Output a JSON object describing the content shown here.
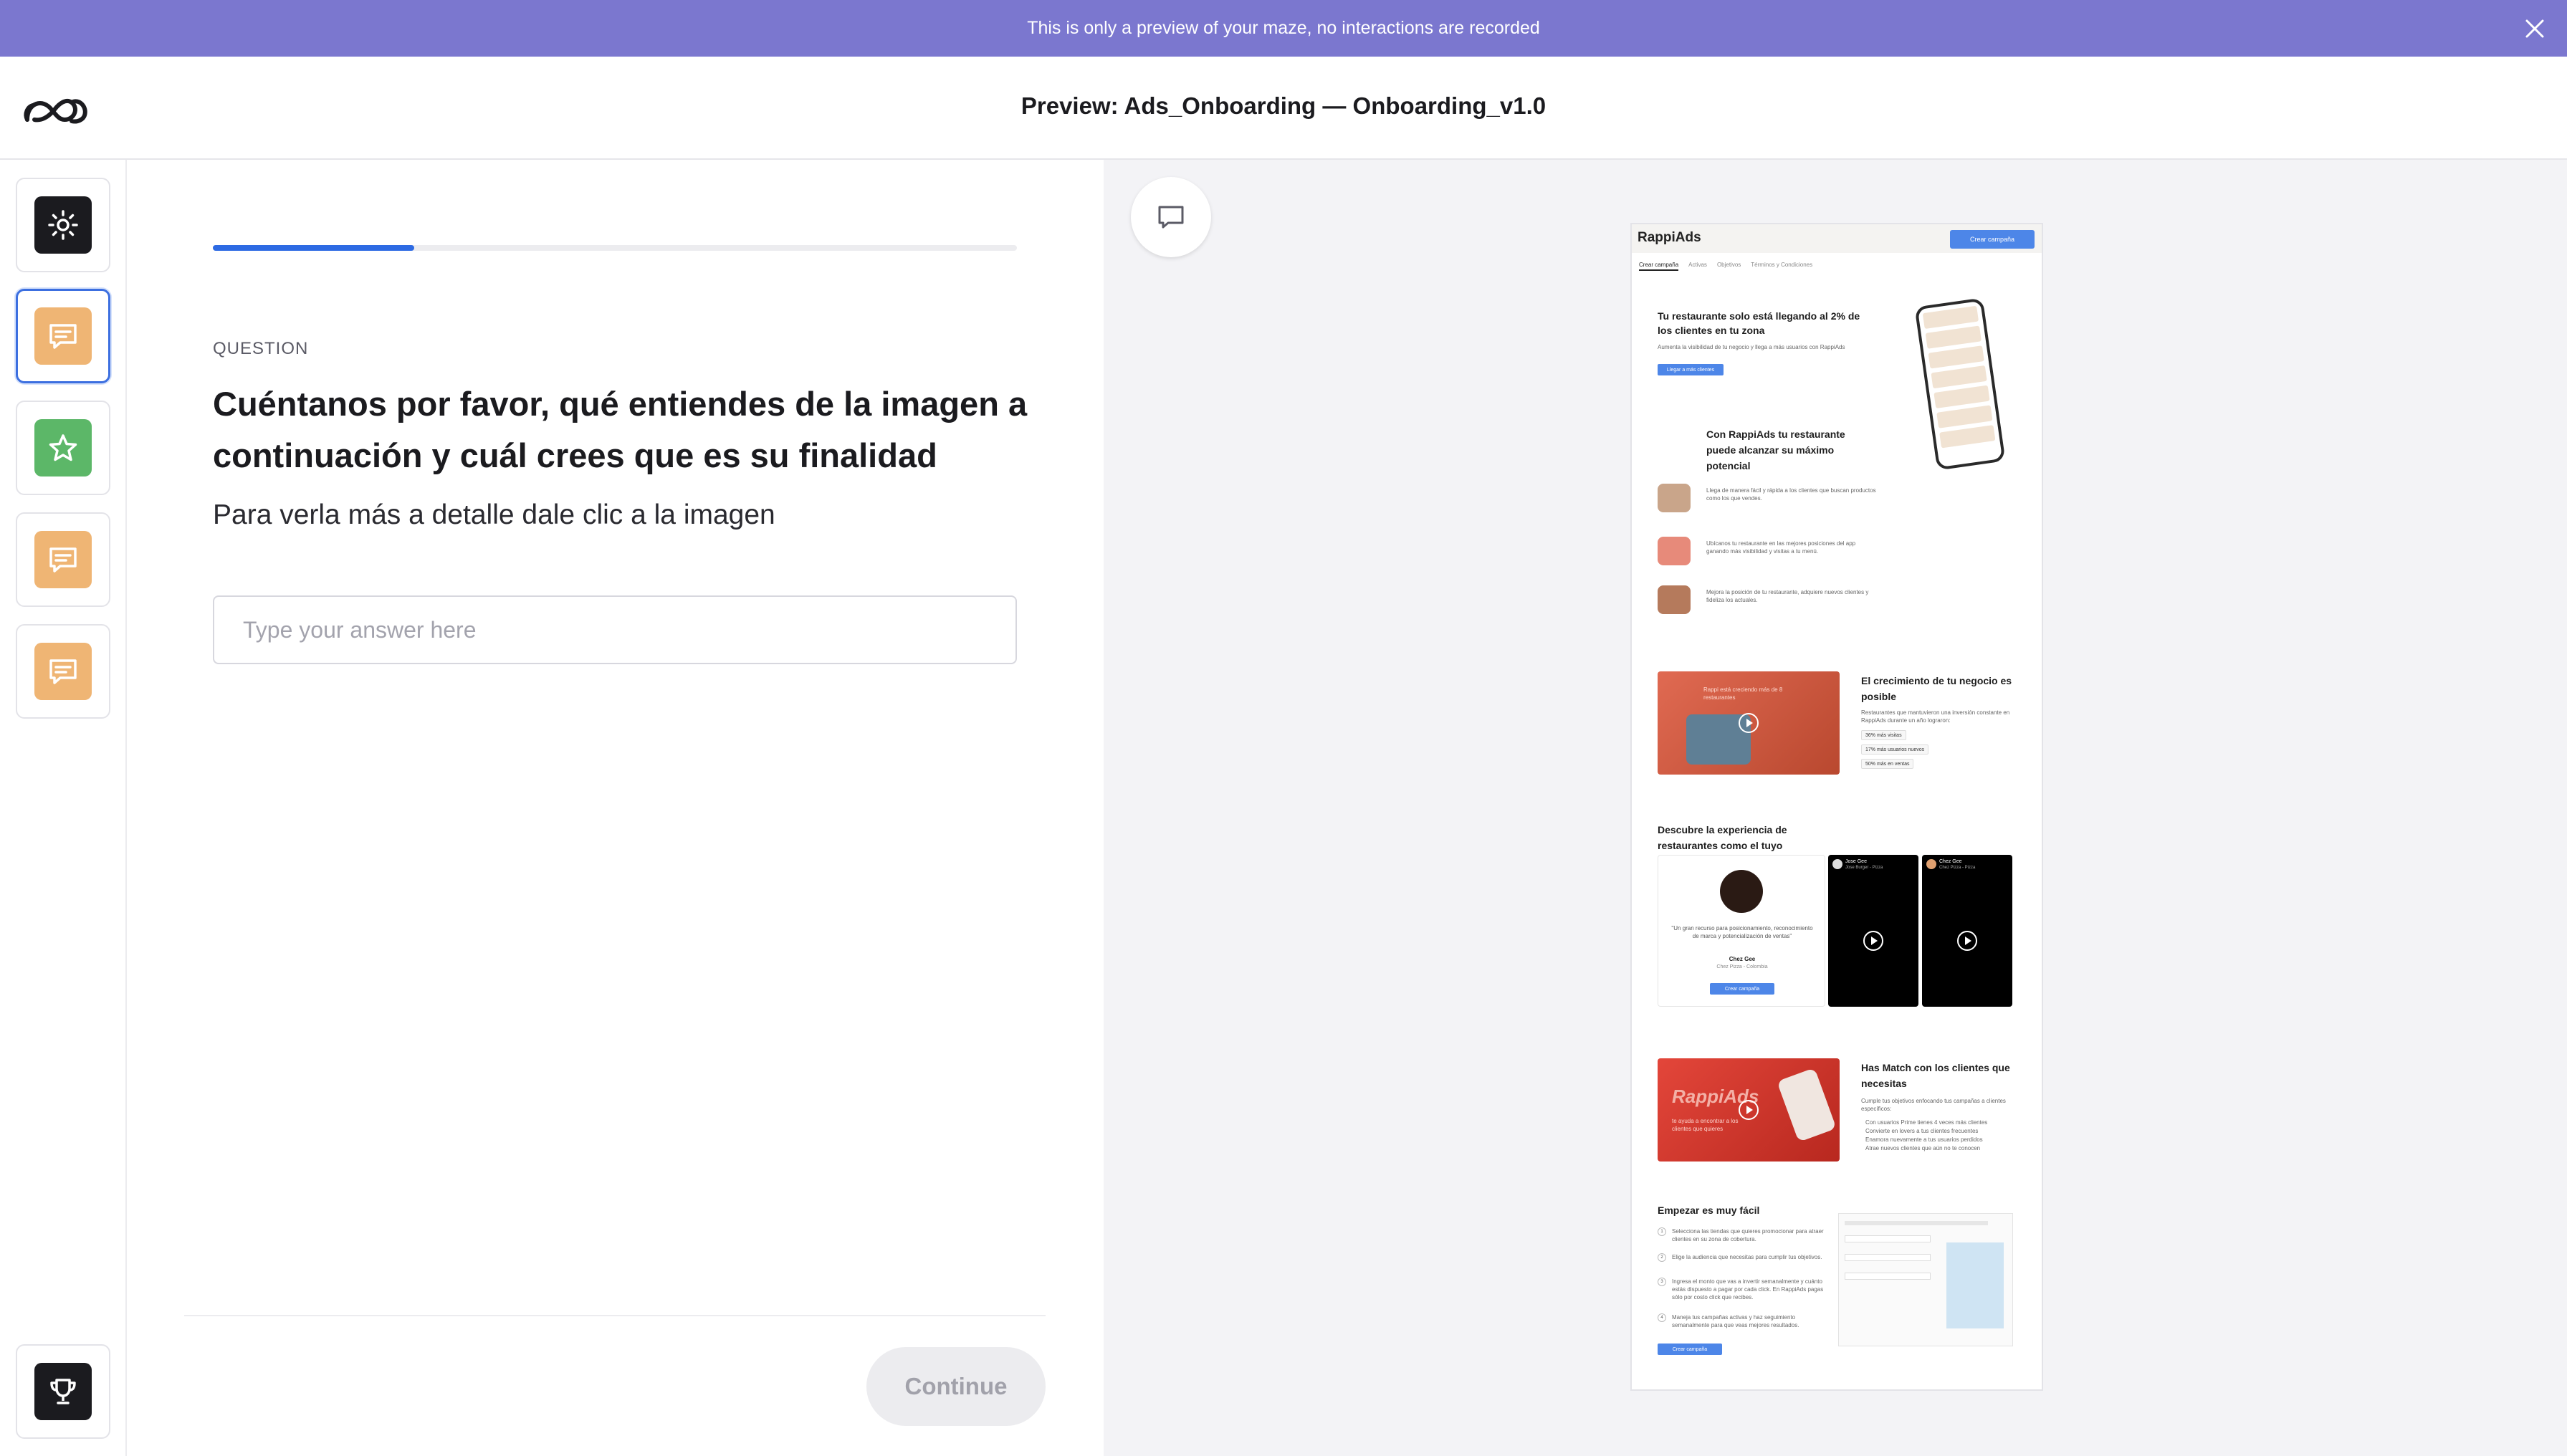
{
  "banner": {
    "text": "This is only a preview of your maze, no interactions are recorded"
  },
  "header": {
    "title": "Preview: Ads_Onboarding — Onboarding_v1.0"
  },
  "rail": {
    "blocks": [
      {
        "type": "welcome",
        "icon": "sun-icon",
        "color": "#1b1b1f"
      },
      {
        "type": "open-question",
        "icon": "chat-icon",
        "color": "#efb574",
        "active": true
      },
      {
        "type": "opinion-scale",
        "icon": "star-icon",
        "color": "#5cb768"
      },
      {
        "type": "open-question",
        "icon": "chat-icon",
        "color": "#efb574"
      },
      {
        "type": "open-question",
        "icon": "chat-icon",
        "color": "#efb574"
      }
    ],
    "bottom": {
      "type": "thank-you",
      "icon": "trophy-icon",
      "color": "#1b1b1f"
    }
  },
  "question": {
    "progress": 0.25,
    "label": "QUESTION",
    "title": "Cuéntanos por favor, qué entiendes de la imagen a continuación y cuál crees que es su finalidad",
    "subtitle": "Para verla más a detalle dale clic a la imagen",
    "answer_value": "",
    "answer_placeholder": "Type your answer here",
    "continue_label": "Continue"
  },
  "preview_image": {
    "brand": "RappiAds",
    "nav_cta": "Crear campaña",
    "tabs": [
      "Crear campaña",
      "Activas",
      "Objetivos",
      "Términos y Condiciones"
    ],
    "hero_title": "Tu restaurante solo está llegando al 2% de los clientes en tu zona",
    "hero_text": "Aumenta la visibilidad de tu negocio y llega a más usuarios con RappiAds",
    "hero_cta": "Llegar a más clientes",
    "potential_title": "Con RappiAds tu restaurante puede alcanzar su máximo potencial",
    "features": [
      "Llega de manera fácil y rápida a los clientes que buscan productos como los que vendes.",
      "Ubícanos tu restaurante en las mejores posiciones del app ganando más visibilidad y visitas a tu menú.",
      "Mejora la posición de tu restaurante, adquiere nuevos clientes y fideliza los actuales."
    ],
    "growth_title": "El crecimiento de tu negocio es posible",
    "growth_text": "Restaurantes que mantuvieron una inversión constante en RappiAds durante un año lograron:",
    "growth_chips": [
      "36% más visitas",
      "17% más usuarios nuevos",
      "50% más en ventas"
    ],
    "video1_caption": "Rappi está creciendo más de 8 restaurantes",
    "experience_title": "Descubre la experiencia de restaurantes como el tuyo",
    "testimonial_quote": "\"Un gran recurso para posicionamiento, reconocimiento de marca y potencialización de ventas\"",
    "testimonial_name": "Chez Gee",
    "testimonial_role": "Chez Pizza - Colombia",
    "testimonial_cta": "Crear campaña",
    "video_cards": [
      {
        "name": "Jose Gee",
        "role": "Jose Burger - Pizza"
      },
      {
        "name": "Chez Gee",
        "role": "Chez Pizza - Pizza"
      }
    ],
    "match_banner": "RappiAds",
    "match_banner_sub": "te ayuda a encontrar a los clientes que quieres",
    "match_title": "Has Match con los clientes que necesitas",
    "match_text": "Cumple tus objetivos enfocando tus campañas a clientes específicos:",
    "match_bullets": [
      "Con usuarios Prime tienes 4 veces más clientes",
      "Convierte en lovers a tus clientes frecuentes",
      "Enamora nuevamente a tus usuarios perdidos",
      "Atrae nuevos clientes que aún no te conocen"
    ],
    "easy_title": "Empezar es muy fácil",
    "steps": [
      "Selecciona las tiendas que quieres promocionar para atraer clientes en su zona de cobertura.",
      "Elige la audiencia que necesitas para cumplir tus objetivos.",
      "Ingresa el monto que vas a invertir semanalmente y cuánto estás dispuesto a pagar por cada click. En RappiAds pagas sólo por costo click que recibes.",
      "Maneja tus campañas activas y haz seguimiento semanalmente para que veas mejores resultados."
    ],
    "easy_cta": "Crear campaña"
  }
}
